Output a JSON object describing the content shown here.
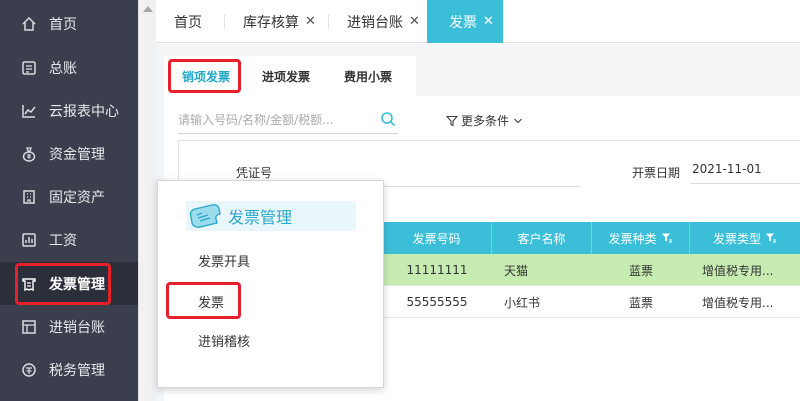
{
  "sidebar": {
    "items": [
      {
        "label": "首页",
        "icon": "home-icon"
      },
      {
        "label": "总账",
        "icon": "ledger-icon"
      },
      {
        "label": "云报表中心",
        "icon": "chart-icon"
      },
      {
        "label": "资金管理",
        "icon": "money-bag-icon"
      },
      {
        "label": "固定资产",
        "icon": "building-icon"
      },
      {
        "label": "工资",
        "icon": "salary-icon"
      },
      {
        "label": "发票管理",
        "icon": "invoice-icon"
      },
      {
        "label": "进销台账",
        "icon": "account-book-icon"
      },
      {
        "label": "税务管理",
        "icon": "tax-icon"
      }
    ],
    "active_index": 6
  },
  "tabs": [
    {
      "label": "首页",
      "closable": false
    },
    {
      "label": "库存核算",
      "closable": true
    },
    {
      "label": "进销台账",
      "closable": true
    },
    {
      "label": "发票",
      "closable": true
    }
  ],
  "subtabs": [
    "销项发票",
    "进项发票",
    "费用小票"
  ],
  "search": {
    "placeholder": "请输入号码/名称/金额/税额..."
  },
  "filter": {
    "more_label": "更多条件"
  },
  "form": {
    "voucher_label": "凭证号",
    "date_label": "开票日期",
    "date_value": "2021-11-01"
  },
  "table": {
    "columns": [
      "发票号码",
      "客户名称",
      "发票种类",
      "发票类型"
    ],
    "rows": [
      {
        "number": "11111111",
        "customer": "天猫",
        "kind": "蓝票",
        "type": "增值税专用..."
      },
      {
        "number": "55555555",
        "customer": "小红书",
        "kind": "蓝票",
        "type": "增值税专用..."
      }
    ]
  },
  "popup": {
    "title": "发票管理",
    "items": [
      "发票开具",
      "发票",
      "进销稽核"
    ]
  },
  "colors": {
    "accent": "#3bbfd9",
    "sidebar_bg": "#3b3f4d",
    "highlight": "#e8202a",
    "selected_row": "#c6ecb2"
  }
}
